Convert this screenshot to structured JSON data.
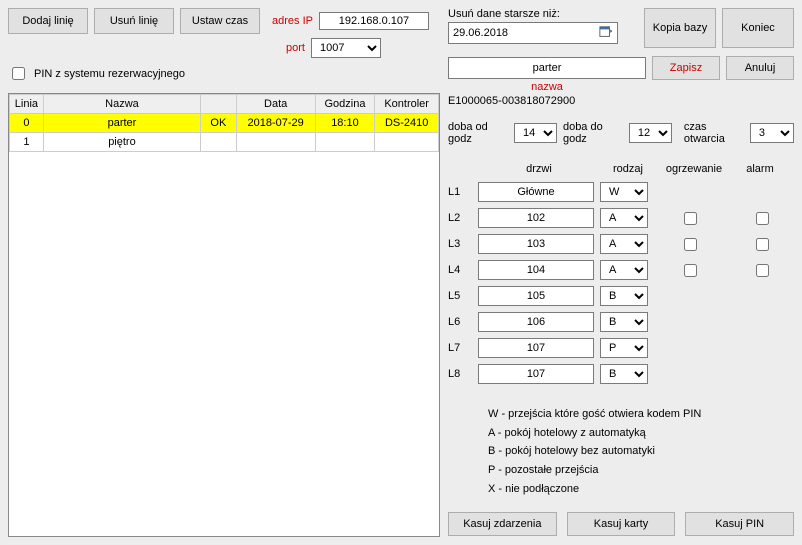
{
  "left": {
    "buttons": {
      "dodaj": "Dodaj linię",
      "usun": "Usuń linię",
      "ustaw": "Ustaw czas"
    },
    "ip_label": "adres IP",
    "ip": "192.168.0.107",
    "port_label": "port",
    "port": "1007",
    "pin_label": "PIN z systemu rezerwacyjnego",
    "pin_checked": false,
    "table": {
      "headers": {
        "linia": "Linia",
        "nazwa": "Nazwa",
        "ok": "",
        "data": "Data",
        "godz": "Godzina",
        "ktrl": "Kontroler"
      },
      "rows": [
        {
          "linia": "0",
          "nazwa": "parter",
          "ok": "OK",
          "data": "2018-07-29",
          "godz": "18:10",
          "ktrl": "DS-2410",
          "selected": true
        },
        {
          "linia": "1",
          "nazwa": "piętro",
          "ok": "",
          "data": "",
          "godz": "",
          "ktrl": "",
          "selected": false
        }
      ]
    }
  },
  "right": {
    "delete_label": "Usuń dane starsze niż:",
    "delete_date": "29.06.2018",
    "kopia": "Kopia bazy",
    "koniec": "Koniec",
    "name": "parter",
    "name_label": "nazwa",
    "zapisz": "Zapisz",
    "anuluj": "Anuluj",
    "controller_id": "E1000065-003818072900",
    "hours": {
      "od_label": "doba od godz",
      "od": "14",
      "do_label": "doba do godz",
      "do": "12",
      "open_label": "czas otwarcia",
      "open": "3"
    },
    "doors_head": {
      "drzwi": "drzwi",
      "rodzaj": "rodzaj",
      "ogrz": "ogrzewanie",
      "alarm": "alarm"
    },
    "doors": [
      {
        "lbl": "L1",
        "name": "Główne",
        "type": "W",
        "ogrz": false,
        "alarm": false,
        "wa": false
      },
      {
        "lbl": "L2",
        "name": "102",
        "type": "A",
        "ogrz": false,
        "alarm": false,
        "wa": true
      },
      {
        "lbl": "L3",
        "name": "103",
        "type": "A",
        "ogrz": false,
        "alarm": false,
        "wa": true
      },
      {
        "lbl": "L4",
        "name": "104",
        "type": "A",
        "ogrz": false,
        "alarm": false,
        "wa": true
      },
      {
        "lbl": "L5",
        "name": "105",
        "type": "B",
        "ogrz": false,
        "alarm": false,
        "wa": false
      },
      {
        "lbl": "L6",
        "name": "106",
        "type": "B",
        "ogrz": false,
        "alarm": false,
        "wa": false
      },
      {
        "lbl": "L7",
        "name": "107",
        "type": "P",
        "ogrz": false,
        "alarm": false,
        "wa": false
      },
      {
        "lbl": "L8",
        "name": "107",
        "type": "B",
        "ogrz": false,
        "alarm": false,
        "wa": false
      }
    ],
    "legend": [
      "W - przejścia które gość otwiera kodem PIN",
      "A - pokój hotelowy z automatyką",
      "B - pokój hotelowy bez automatyki",
      "P - pozostałe przejścia",
      "X - nie podłączone"
    ],
    "bottom": {
      "kz": "Kasuj zdarzenia",
      "kk": "Kasuj karty",
      "kp": "Kasuj PIN"
    }
  }
}
